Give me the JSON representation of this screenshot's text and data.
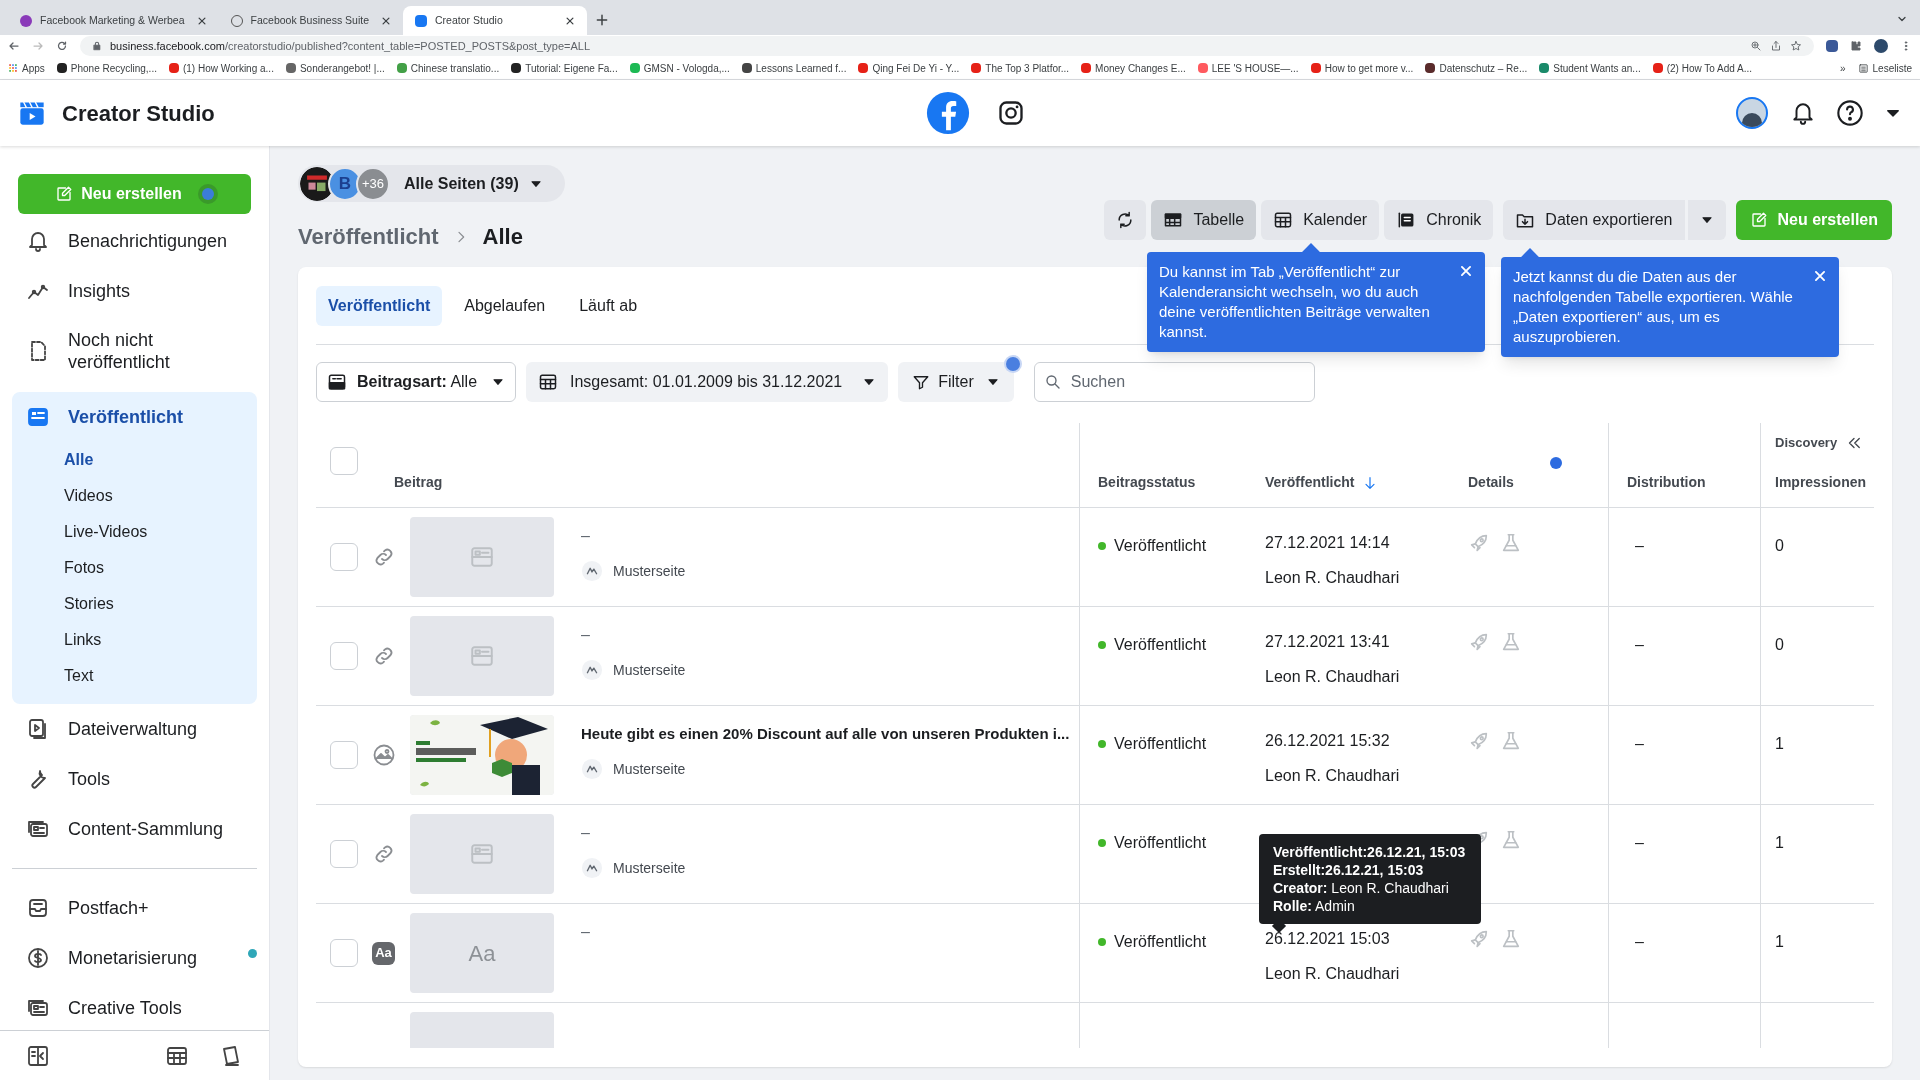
{
  "browser": {
    "tabs": [
      {
        "title": "Facebook Marketing & Werbea",
        "selected": false
      },
      {
        "title": "Facebook Business Suite",
        "selected": false
      },
      {
        "title": "Creator Studio",
        "selected": true
      }
    ],
    "url_host": "business.facebook.com",
    "url_path": "/creatorstudio/published?content_table=POSTED_POSTS&post_type=ALL",
    "apps": "Apps",
    "bookmarks": [
      "Phone Recycling,...",
      "(1) How Working a...",
      "Sonderangebot! |...",
      "Chinese translatio...",
      "Tutorial: Eigene Fa...",
      "GMSN - Vologda,...",
      "Lessons Learned f...",
      "Qing Fei De Yi - Y...",
      "The Top 3 Platfor...",
      "Money Changes E...",
      "LEE 'S HOUSE—...",
      "How to get more v...",
      "Datenschutz – Re...",
      "Student Wants an...",
      "(2) How To Add A..."
    ],
    "more": "»",
    "reading_list": "Leseliste"
  },
  "header": {
    "title": "Creator Studio",
    "platforms": [
      {
        "selected": true
      },
      {
        "selected": false
      }
    ]
  },
  "sidebar": {
    "create_button": "Neu erstellen",
    "create_dot": true,
    "sections": [
      {
        "items": [
          {
            "label": "Benachrichtigungen",
            "selected": false,
            "dot": false
          },
          {
            "label": "Insights",
            "selected": false,
            "dot": false
          },
          {
            "label": "Noch nicht veröffentlicht",
            "selected": false,
            "dot": false
          },
          {
            "label": "Veröffentlicht",
            "selected": true,
            "dot": false,
            "children": [
              {
                "label": "Alle",
                "selected": true
              },
              {
                "label": "Videos",
                "selected": false
              },
              {
                "label": "Live-Videos",
                "selected": false
              },
              {
                "label": "Fotos",
                "selected": false
              },
              {
                "label": "Stories",
                "selected": false
              },
              {
                "label": "Links",
                "selected": false
              },
              {
                "label": "Text",
                "selected": false
              }
            ]
          },
          {
            "label": "Dateiverwaltung",
            "selected": false,
            "dot": false
          },
          {
            "label": "Tools",
            "selected": false,
            "dot": false
          },
          {
            "label": "Content-Sammlung",
            "selected": false,
            "dot": false
          }
        ]
      },
      {
        "items": [
          {
            "label": "Postfach+",
            "selected": false,
            "dot": false
          },
          {
            "label": "Monetarisierung",
            "selected": false,
            "dot": true
          },
          {
            "label": "Creative Tools",
            "selected": false,
            "dot": false
          }
        ]
      }
    ]
  },
  "page_selector": {
    "label": "Alle Seiten (39)",
    "avatars": [
      {
        "kind": "picture"
      },
      {
        "kind": "letter",
        "text": "B"
      },
      {
        "kind": "count",
        "text": "+36"
      }
    ]
  },
  "breadcrumb": [
    "Veröffentlicht",
    "Alle"
  ],
  "views": [
    {
      "label": "Tabelle",
      "selected": true
    },
    {
      "label": "Kalender",
      "selected": false
    },
    {
      "label": "Chronik",
      "selected": false
    }
  ],
  "export_button": "Daten exportieren",
  "create_button": "Neu erstellen",
  "callouts": [
    "Du kannst im Tab „Veröffentlicht“ zur Kalenderansicht wechseln, wo du auch deine veröffentlichten Beiträge verwalten kannst.",
    "Jetzt kannst du die Daten aus der nachfolgenden Tabelle exportieren. Wähle „Daten exportieren“ aus, um es auszuprobieren."
  ],
  "tabs": [
    {
      "label": "Veröffentlicht",
      "selected": true
    },
    {
      "label": "Abgelaufen",
      "selected": false
    },
    {
      "label": "Läuft ab",
      "selected": false
    }
  ],
  "filters": {
    "type_label": "Beitragsart:",
    "type_value": "Alle",
    "date": "Insgesamt: 01.01.2009 bis 31.12.2021",
    "filter": "Filter",
    "filter_dot": true,
    "search_placeholder": "Suchen"
  },
  "table": {
    "group": "Discovery",
    "select_all_checked": false,
    "details_dot": true,
    "columns": [
      {
        "label": "Beitrag",
        "sorted": false
      },
      {
        "label": "Beitragsstatus",
        "sorted": false
      },
      {
        "label": "Veröffentlicht",
        "sorted": true
      },
      {
        "label": "Details",
        "sorted": false
      },
      {
        "label": "Distribution",
        "sorted": false
      },
      {
        "label": "Impressionen",
        "sorted": false
      }
    ],
    "rows": [
      {
        "kind": "link",
        "title": "–",
        "page": "Musterseite",
        "status": "Veröffentlicht",
        "date": "27.12.2021 14:14",
        "author": "Leon R. Chaudhari",
        "distribution": "–",
        "impressions": "0",
        "checked": false
      },
      {
        "kind": "link",
        "title": "–",
        "page": "Musterseite",
        "status": "Veröffentlicht",
        "date": "27.12.2021 13:41",
        "author": "Leon R. Chaudhari",
        "distribution": "–",
        "impressions": "0",
        "checked": false
      },
      {
        "title": "Heute gibt es einen 20% Discount auf alle von unseren Produkten i...",
        "page": "Musterseite",
        "status": "Veröffentlicht",
        "date": "26.12.2021 15:32",
        "author": "Leon R. Chaudhari",
        "distribution": "–",
        "impressions": "1",
        "checked": false
      },
      {
        "kind": "link",
        "title": "–",
        "page": "Musterseite",
        "status": "Veröffentlicht",
        "distribution": "–",
        "impressions": "1",
        "checked": false
      },
      {
        "kind": "text",
        "glyph": "Aa",
        "thumb_text": "Aa",
        "title": "–",
        "status": "Veröffentlicht",
        "date": "26.12.2021 15:03",
        "author": "Leon R. Chaudhari",
        "distribution": "–",
        "impressions": "1",
        "checked": false
      },
      {
        "kind": "partial"
      }
    ]
  },
  "hover_tooltip": [
    "**Veröffentlicht:26.12.21, 15:03**",
    "**Erstellt:26.12.21, 15:03**",
    "**Creator:** Leon R. Chaudhari",
    "**Rolle:** Admin"
  ]
}
